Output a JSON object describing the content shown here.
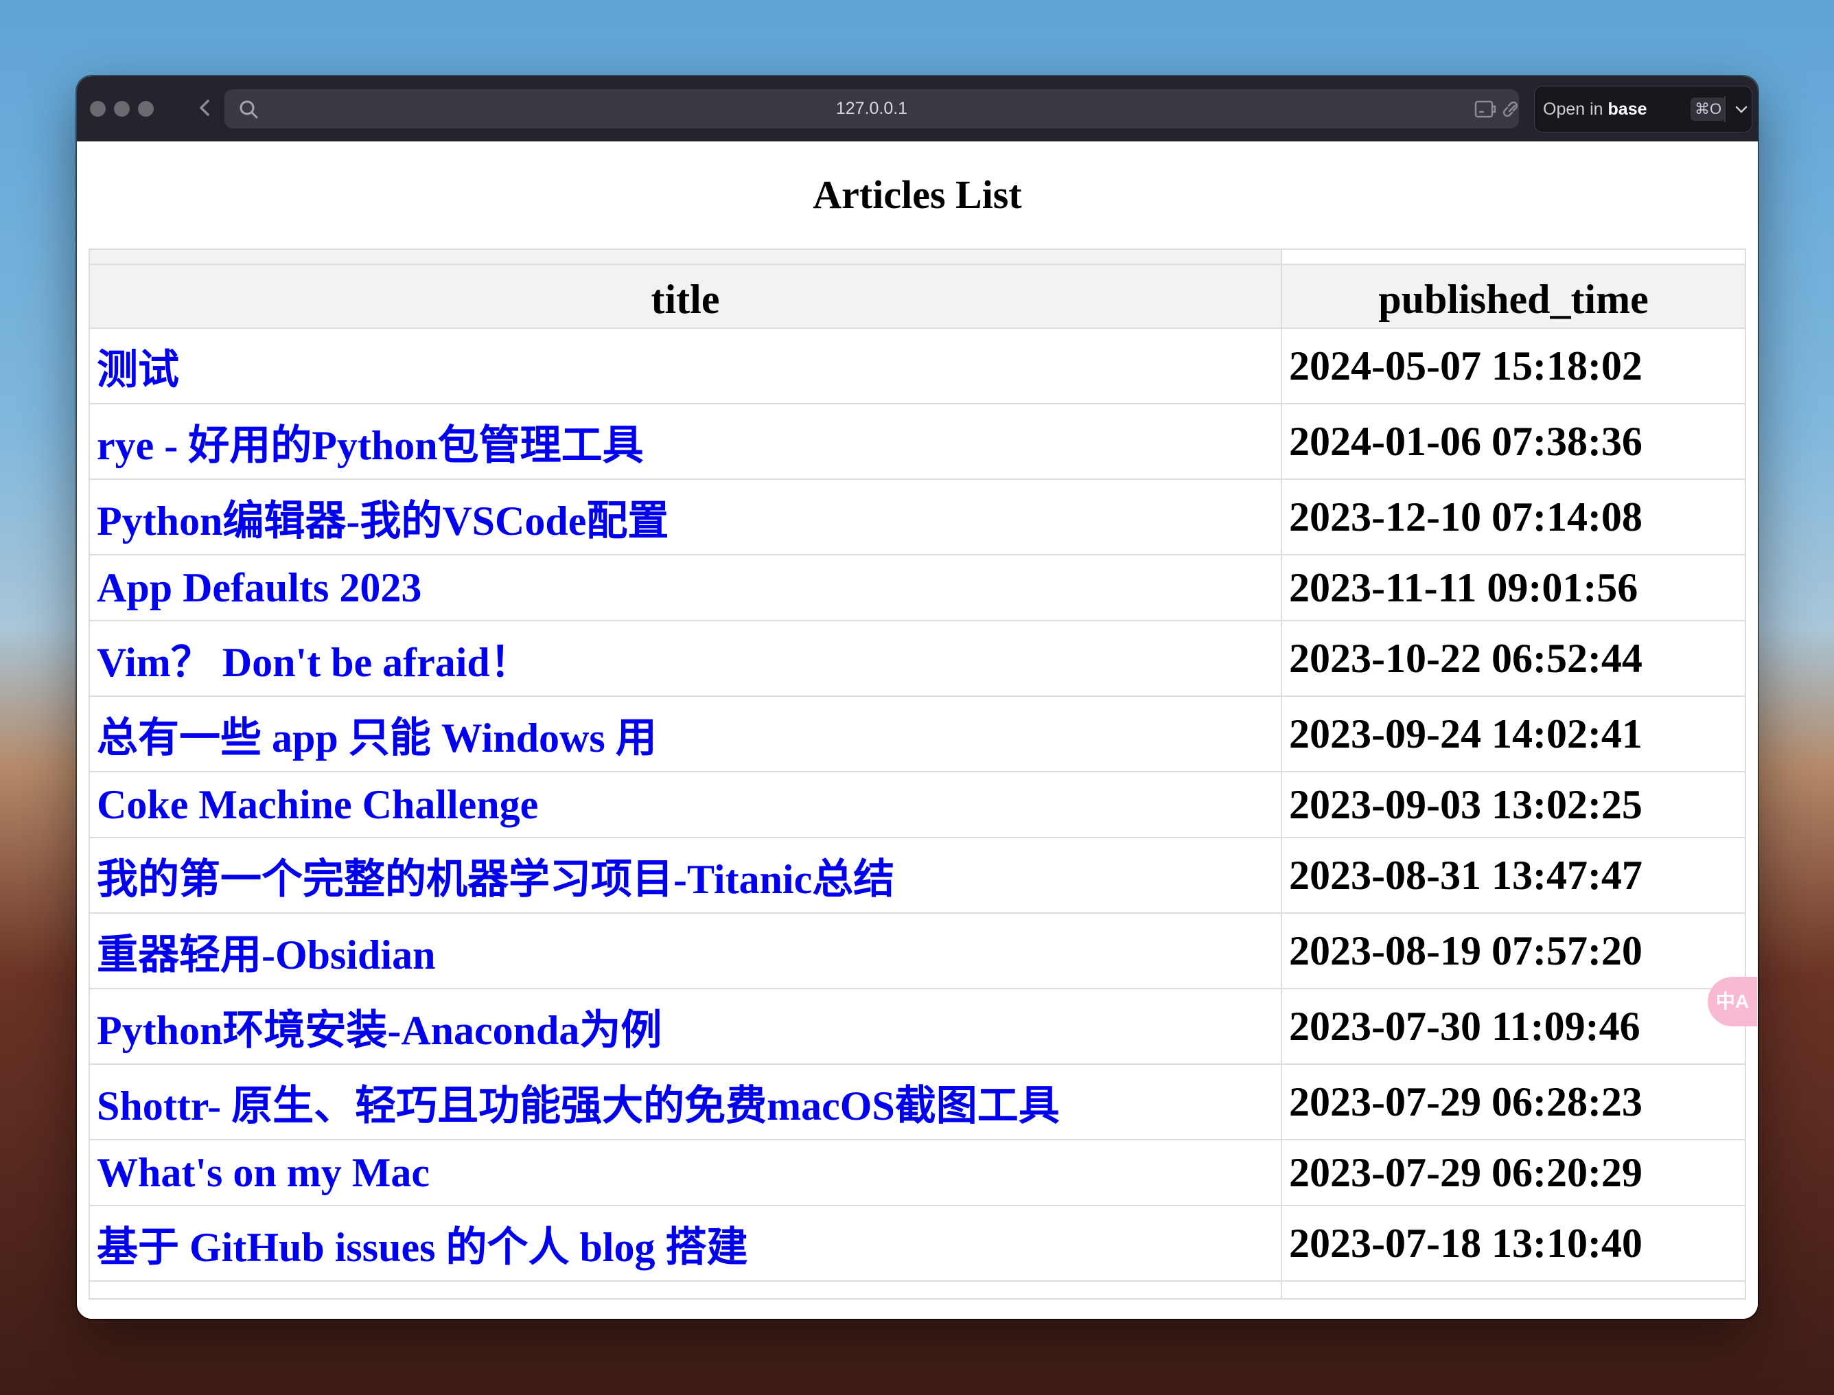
{
  "browser": {
    "url": "127.0.0.1",
    "open_in_prefix": "Open in",
    "open_in_app": "base",
    "open_in_shortcut": "⌘O",
    "icons": [
      "back-chevron-icon",
      "search-icon",
      "extension-icon",
      "link-icon",
      "chevron-down-icon"
    ]
  },
  "page": {
    "title": "Articles List",
    "columns": [
      "title",
      "published_time"
    ],
    "rows": [
      {
        "title": "测试",
        "published_time": "2024-05-07 15:18:02"
      },
      {
        "title": "rye - 好用的Python包管理工具",
        "published_time": "2024-01-06 07:38:36"
      },
      {
        "title": "Python编辑器-我的VSCode配置",
        "published_time": "2023-12-10 07:14:08"
      },
      {
        "title": "App Defaults 2023",
        "published_time": "2023-11-11 09:01:56"
      },
      {
        "title": "Vim？ Don't be afraid！",
        "published_time": "2023-10-22 06:52:44"
      },
      {
        "title": "总有一些 app 只能 Windows 用",
        "published_time": "2023-09-24 14:02:41"
      },
      {
        "title": "Coke Machine Challenge",
        "published_time": "2023-09-03 13:02:25"
      },
      {
        "title": "我的第一个完整的机器学习项目-Titanic总结",
        "published_time": "2023-08-31 13:47:47"
      },
      {
        "title": "重器轻用-Obsidian",
        "published_time": "2023-08-19 07:57:20"
      },
      {
        "title": "Python环境安装-Anaconda为例",
        "published_time": "2023-07-30 11:09:46"
      },
      {
        "title": "Shottr- 原生、轻巧且功能强大的免费macOS截图工具",
        "published_time": "2023-07-29 06:28:23"
      },
      {
        "title": "What's on my Mac",
        "published_time": "2023-07-29 06:20:29"
      },
      {
        "title": "基于 GitHub issues 的个人 blog 搭建",
        "published_time": "2023-07-18 13:10:40"
      }
    ]
  },
  "translate_button": {
    "label": "中A"
  },
  "colors": {
    "link": "#0000ee",
    "header_bg": "#f2f2f2",
    "toolbar": "#26232c",
    "translate": "#f9b9d2"
  }
}
